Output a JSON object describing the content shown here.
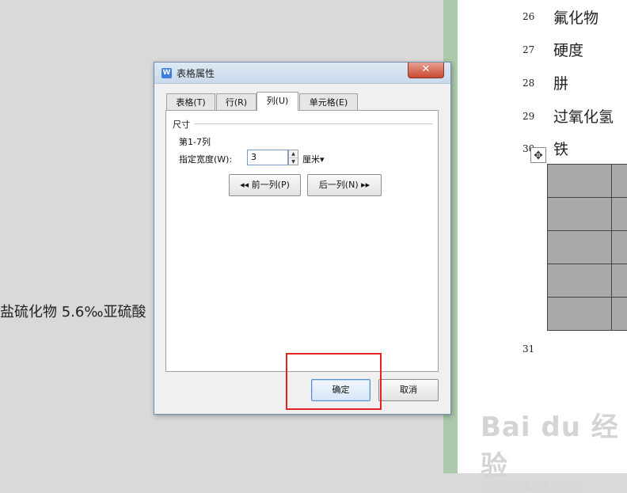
{
  "background": {
    "left_text": "盐硫化物 5.6‰亚硫酸",
    "rows": [
      {
        "num": "26",
        "text": "氟化物"
      },
      {
        "num": "27",
        "text": "硬度"
      },
      {
        "num": "28",
        "text": "肼"
      },
      {
        "num": "29",
        "text": "过氧化氢"
      },
      {
        "num": "30",
        "text": "铁"
      },
      {
        "num": "31",
        "text": ""
      }
    ],
    "move_handle": "✥",
    "watermark_main": "Bai du 经验",
    "watermark_sub": "jingyan.baidu.com"
  },
  "dialog": {
    "title": "表格属性",
    "icon_letter": "W",
    "close_glyph": "✕",
    "tabs": [
      {
        "label": "表格(T)",
        "active": false
      },
      {
        "label": "行(R)",
        "active": false
      },
      {
        "label": "列(U)",
        "active": true
      },
      {
        "label": "单元格(E)",
        "active": false
      }
    ],
    "group_label": "尺寸",
    "column_range": "第1-7列",
    "width_label": "指定宽度(W):",
    "width_value": "3",
    "unit": "厘米▾",
    "prev_button": "◂◂ 前一列(P)",
    "next_button": "后一列(N) ▸▸",
    "ok_button": "确定",
    "cancel_button": "取消"
  },
  "colors": {
    "highlight_box": "#e32222",
    "title_bar": "#c9d9ec",
    "sidebar_strip": "#adc8ab"
  }
}
